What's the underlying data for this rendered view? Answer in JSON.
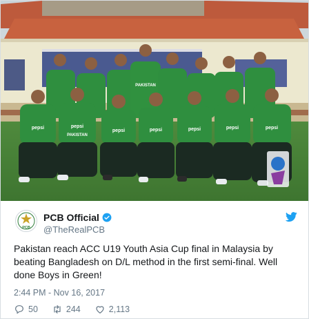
{
  "tweet": {
    "display_name": "PCB Official",
    "handle": "@TheRealPCB",
    "verified": true,
    "avatar_text": "PCB",
    "text": "Pakistan reach ACC U19 Youth Asia Cup final in Malaysia by beating Bangladesh on D/L method in the first semi-final. Well done Boys in Green!",
    "timestamp": "2:44 PM - Nov 16, 2017",
    "replies": "50",
    "retweets": "244",
    "likes": "2,113"
  },
  "photo": {
    "jersey_sponsor": "pepsi",
    "jersey_text": "PAKISTAN"
  },
  "colors": {
    "brand_twitter": "#1da1f2",
    "jersey_green": "#2f8f3f",
    "trouser_dark": "#1b2a22",
    "text_secondary": "#657786"
  },
  "icons": [
    "verified-badge-icon",
    "twitter-bird-icon",
    "reply-icon",
    "retweet-icon",
    "like-icon"
  ]
}
